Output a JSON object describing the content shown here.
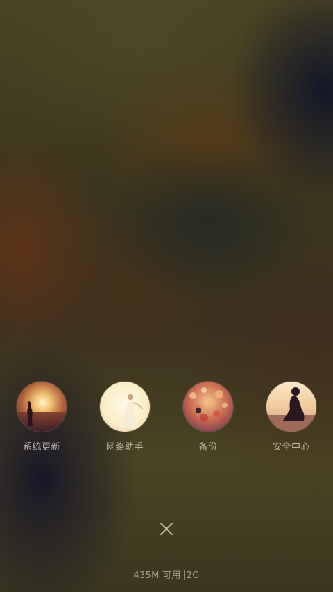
{
  "shortcuts": [
    {
      "label": "系统更新",
      "icon": "sunset-photo-icon"
    },
    {
      "label": "网络助手",
      "icon": "dress-girl-photo-icon"
    },
    {
      "label": "备份",
      "icon": "flower-field-photo-icon"
    },
    {
      "label": "安全中心",
      "icon": "beach-sitting-photo-icon"
    }
  ],
  "close": {
    "icon": "close-icon"
  },
  "status": {
    "memory_available": "435M 可用",
    "network": "2G"
  }
}
